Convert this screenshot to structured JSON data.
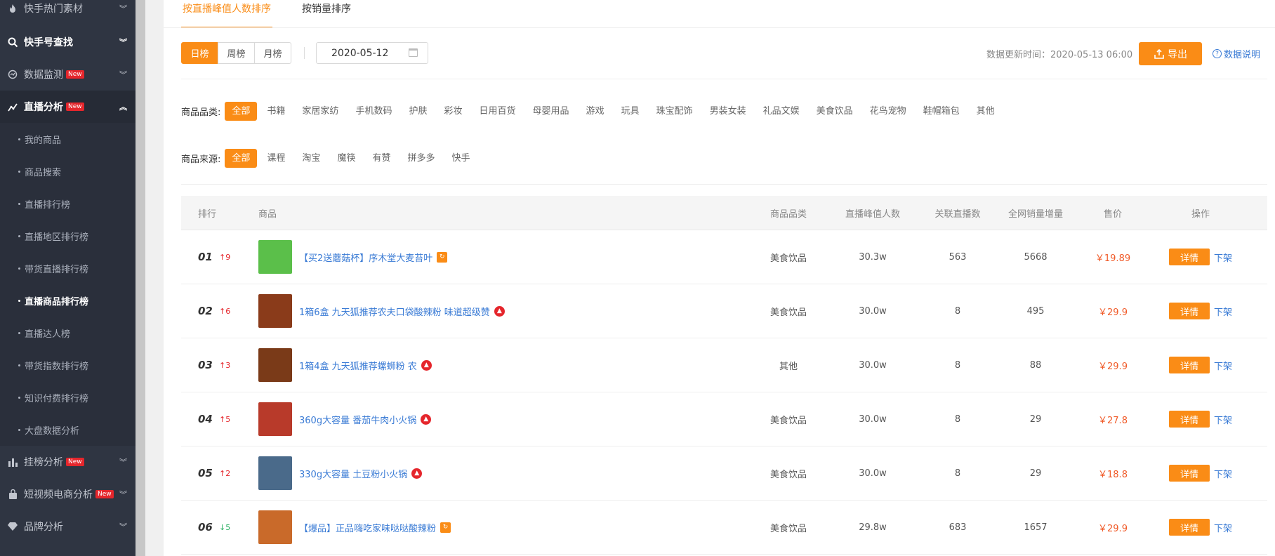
{
  "sidebar": {
    "items_top": [
      {
        "label": "快手热门素材"
      },
      {
        "label": "快手号查找"
      },
      {
        "label": "数据监测",
        "badge": "New"
      },
      {
        "label": "直播分析",
        "badge": "New"
      }
    ],
    "sub_items": [
      {
        "label": "我的商品"
      },
      {
        "label": "商品搜索"
      },
      {
        "label": "直播排行榜"
      },
      {
        "label": "直播地区排行榜"
      },
      {
        "label": "带货直播排行榜"
      },
      {
        "label": "直播商品排行榜"
      },
      {
        "label": "直播达人榜"
      },
      {
        "label": "带货指数排行榜"
      },
      {
        "label": "知识付费排行榜"
      },
      {
        "label": "大盘数据分析"
      }
    ],
    "items_bottom": [
      {
        "label": "挂榜分析",
        "badge": "New"
      },
      {
        "label": "短视频电商分析",
        "badge": "New"
      },
      {
        "label": "品牌分析"
      }
    ]
  },
  "tabs": [
    {
      "label": "按直播峰值人数排序"
    },
    {
      "label": "按销量排序"
    }
  ],
  "period": {
    "options": [
      "日榜",
      "周榜",
      "月榜"
    ],
    "selected": "日榜"
  },
  "date": "2020-05-12",
  "update_time": "数据更新时间：2020-05-13 06:00",
  "export_label": "导出",
  "data_note_label": "数据说明",
  "category_filter": {
    "label": "商品品类:",
    "options": [
      "全部",
      "书籍",
      "家居家纺",
      "手机数码",
      "护肤",
      "彩妆",
      "日用百货",
      "母婴用品",
      "游戏",
      "玩具",
      "珠宝配饰",
      "男装女装",
      "礼品文娱",
      "美食饮品",
      "花鸟宠物",
      "鞋帽箱包",
      "其他"
    ],
    "selected": "全部"
  },
  "source_filter": {
    "label": "商品来源:",
    "options": [
      "全部",
      "课程",
      "淘宝",
      "魔筷",
      "有赞",
      "拼多多",
      "快手"
    ],
    "selected": "全部"
  },
  "table": {
    "headers": [
      "排行",
      "商品",
      "商品品类",
      "直播峰值人数",
      "关联直播数",
      "全网销量增量",
      "售价",
      "操作"
    ],
    "detail_label": "详情",
    "offshelf_label": "下架",
    "rows": [
      {
        "rank": "01",
        "trend": "↑9",
        "trend_dir": "up",
        "name": "【买2送蘑菇杯】序木堂大麦苔叶",
        "tag": "square",
        "category": "美食饮品",
        "peak": "30.3w",
        "lives": "563",
        "sales": "5668",
        "price": "￥19.89",
        "thumb": "#5bbf4a"
      },
      {
        "rank": "02",
        "trend": "↑6",
        "trend_dir": "up",
        "name": "1箱6盒 九天狐推荐农夫口袋酸辣粉 味道超级赞",
        "tag": "circle",
        "category": "美食饮品",
        "peak": "30.0w",
        "lives": "8",
        "sales": "495",
        "price": "￥29.9",
        "thumb": "#8a3b1a"
      },
      {
        "rank": "03",
        "trend": "↑3",
        "trend_dir": "up",
        "name": "1箱4盒 九天狐推荐螺蛳粉 农",
        "tag": "circle",
        "category": "其他",
        "peak": "30.0w",
        "lives": "8",
        "sales": "88",
        "price": "￥29.9",
        "thumb": "#7a3a18"
      },
      {
        "rank": "04",
        "trend": "↑5",
        "trend_dir": "up",
        "name": "360g大容量 番茄牛肉小火锅",
        "tag": "circle",
        "category": "美食饮品",
        "peak": "30.0w",
        "lives": "8",
        "sales": "29",
        "price": "￥27.8",
        "thumb": "#b83a2a"
      },
      {
        "rank": "05",
        "trend": "↑2",
        "trend_dir": "up",
        "name": "330g大容量 土豆粉小火锅",
        "tag": "circle",
        "category": "美食饮品",
        "peak": "30.0w",
        "lives": "8",
        "sales": "29",
        "price": "￥18.8",
        "thumb": "#4a6a8a"
      },
      {
        "rank": "06",
        "trend": "↓5",
        "trend_dir": "down",
        "name": "【爆品】正品嗨吃家味哒哒酸辣粉",
        "tag": "square",
        "category": "美食饮品",
        "peak": "29.8w",
        "lives": "683",
        "sales": "1657",
        "price": "￥29.9",
        "thumb": "#c96a2a"
      }
    ]
  },
  "colors": {
    "accent": "#fa8c16",
    "link": "#3a7bd5",
    "sidebar_bg": "#2f3542",
    "price": "#f05a28",
    "up": "#e5262c",
    "down": "#27ae60"
  }
}
